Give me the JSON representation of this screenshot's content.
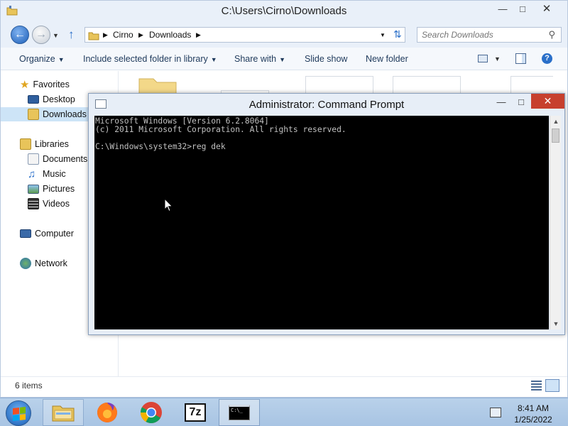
{
  "explorer": {
    "title": "C:\\Users\\Cirno\\Downloads",
    "breadcrumb": [
      "Cirno",
      "Downloads"
    ],
    "search_placeholder": "Search Downloads",
    "toolbar": {
      "organize": "Organize",
      "include_library": "Include selected folder in library",
      "share_with": "Share with",
      "slide_show": "Slide show",
      "new_folder": "New folder"
    },
    "nav": {
      "favorites": "Favorites",
      "desktop": "Desktop",
      "downloads": "Downloads",
      "libraries": "Libraries",
      "documents": "Documents",
      "music": "Music",
      "pictures": "Pictures",
      "videos": "Videos",
      "computer": "Computer",
      "network": "Network"
    },
    "status": "6 items"
  },
  "cmd": {
    "title": "Administrator: Command Prompt",
    "lines": [
      "Microsoft Windows [Version 6.2.8064]",
      "(c) 2011 Microsoft Corporation. All rights reserved.",
      "",
      "C:\\Windows\\system32>reg dek"
    ]
  },
  "taskbar": {
    "time": "8:41 AM",
    "date": "1/25/2022",
    "apps": [
      "file-explorer",
      "firefox",
      "chrome",
      "7-zip",
      "command-prompt"
    ],
    "seven_zip_label": "7z",
    "cmd_label": "C:\\_"
  }
}
